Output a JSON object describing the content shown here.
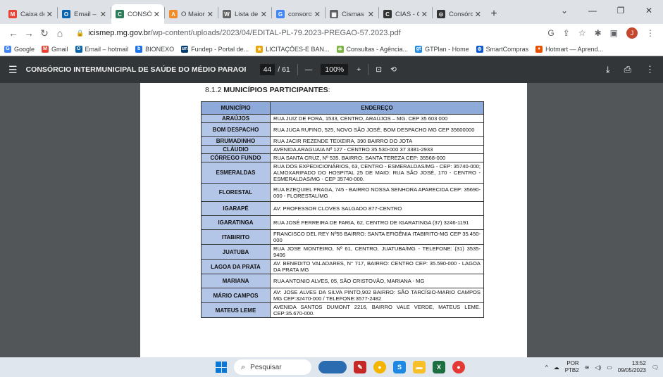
{
  "tabs": [
    {
      "icon": "gmail-icon",
      "color": "#ea4335",
      "glyph": "M",
      "title": "Caixa de e"
    },
    {
      "icon": "outlook-icon",
      "color": "#0a64ad",
      "glyph": "O",
      "title": "Email – Jul"
    },
    {
      "icon": "consorcio-icon",
      "color": "#2e7d5b",
      "glyph": "C",
      "title": "CONSÓRC",
      "active": true
    },
    {
      "icon": "maior-icon",
      "color": "#f28c28",
      "glyph": "Λ",
      "title": "O Maior M"
    },
    {
      "icon": "wikipedia-icon",
      "color": "#666666",
      "glyph": "W",
      "title": "Lista de m"
    },
    {
      "icon": "google-icon",
      "color": "#4285f4",
      "glyph": "G",
      "title": "consorcio"
    },
    {
      "icon": "cismas-icon",
      "color": "#5f6368",
      "glyph": "▦",
      "title": "Cismas - C"
    },
    {
      "icon": "cias-icon",
      "color": "#333333",
      "glyph": "C",
      "title": "CIAS - Con"
    },
    {
      "icon": "consorcio2-icon",
      "color": "#333333",
      "glyph": "⊙",
      "title": "Consórcio"
    }
  ],
  "address": {
    "host": "icismep.mg.gov.br",
    "path": "/wp-content/uploads/2023/04/EDITAL-PL-79.2023-PREGAO-57.2023.pdf",
    "profile_initial": "J"
  },
  "bookmarks": [
    {
      "glyph": "G",
      "color": "#4285f4",
      "label": "Google"
    },
    {
      "glyph": "M",
      "color": "#ea4335",
      "label": "Gmail"
    },
    {
      "glyph": "O",
      "color": "#0a64ad",
      "label": "Email – hotmail"
    },
    {
      "glyph": "b",
      "color": "#1a73e8",
      "label": "BIONEXO"
    },
    {
      "glyph": "un",
      "color": "#003c71",
      "label": "Fundep - Portal de..."
    },
    {
      "glyph": "★",
      "color": "#e8a400",
      "label": "LICITAÇÕES-E BAN..."
    },
    {
      "glyph": "✲",
      "color": "#7cb342",
      "label": "Consultas - Agência..."
    },
    {
      "glyph": "gt",
      "color": "#1e88e5",
      "label": "GTPlan - Home"
    },
    {
      "glyph": "⚙",
      "color": "#0b57d0",
      "label": "SmartCompras"
    },
    {
      "glyph": "♦",
      "color": "#e65100",
      "label": "Hotmart — Aprend..."
    }
  ],
  "pdf": {
    "title": "CONSÓRCIO INTERMUNICIPAL DE SAÚDE DO MÉDIO PARAOPEBA – C...",
    "page_current": "44",
    "page_total": "/ 61",
    "zoom": "100%"
  },
  "document": {
    "section_number": "8.1.2",
    "section_title": "MUNICÍPIOS PARTICIPANTES",
    "section_suffix": ":",
    "col_municipio": "MUNICÍPIO",
    "col_endereco": "ENDEREÇO",
    "rows": [
      {
        "municipio": "ARAÚJOS",
        "endereco": "RUA JUIZ DE FORA, 1533, CENTRO, ARAÚJOS – MG. CEP 35 603 000",
        "h": "r1"
      },
      {
        "municipio": "BOM DESPACHO",
        "endereco": "RUA JUCA RUFINO, 525, NOVO SÃO JOSÉ, BOM DESPACHO MG CEP 35600000",
        "h": "r2"
      },
      {
        "municipio": "BRUMADINHO",
        "endereco": "RUA JACIR REZENDE TEIXEIRA, 390 BAIRRO DO JOTA",
        "h": "r1"
      },
      {
        "municipio": "CLÁUDIO",
        "endereco": "AVENIDA ARAGUAIA Nº 127 - CENTRO 35.530-000 37 3381-2933",
        "h": "r1"
      },
      {
        "municipio": "CÓRREGO FUNDO",
        "endereco": "RUA SANTA CRUZ, Nº 535. BAIRRO: SANTA TEREZA CEP: 35568-000",
        "h": "r1"
      },
      {
        "municipio": "ESMERALDAS",
        "endereco": "RUA DOS EXPEDICIONÁRIOS, 63, CENTRO - ESMERALDAS/MG - CEP: 35740-000; ALMOXARIFADO DO HOSPITAL 25 DE MAIO: RUA SÃO JOSÉ, 170 - CENTRO - ESMERALDAS/MG - CEP 35740-000.",
        "h": "r3"
      },
      {
        "municipio": "FLORESTAL",
        "endereco": "RUA EZEQUIEL FRAGA, 745 - BAIRRO NOSSA SENHORA APARECIDA CEP: 35690-000 - FLORESTAL/MG",
        "h": "r4"
      },
      {
        "municipio": "IGARAPÉ",
        "endereco": "AV: PROFESSOR CLOVES SALGADO 877-CENTRO",
        "h": "r2"
      },
      {
        "municipio": "IGARATINGA",
        "endereco": "RUA JOSÉ FERREIRA DE FARIA, 62, CENTRO DE IGARATINGA (37) 3246-1191",
        "h": "r2"
      },
      {
        "municipio": "ITABIRITO",
        "endereco": "FRANCISCO DEL REY Nº55 BAIRRO: SANTA EFIGÊNIA ITABIRITO-MG CEP 35.450-000",
        "h": "r2"
      },
      {
        "municipio": "JUATUBA",
        "endereco": "RUA JOSE MONTEIRO, Nº 61, CENTRO, JUATUBA/MG - TELEFONE: (31) 3535-9406",
        "h": "r2"
      },
      {
        "municipio": "LAGOA DA PRATA",
        "endereco": "AV. BENEDITO VALADARES, N° 717, BAIRRO: CENTRO CEP: 35.590-000 - LAGOA DA PRATA MG",
        "h": "r2"
      },
      {
        "municipio": "MARIANA",
        "endereco": "RUA ANTONIO ALVES, 05, SÃO CRISTOVÃO, MARIANA - MG",
        "h": "r2"
      },
      {
        "municipio": "MÁRIO CAMPOS",
        "endereco": "AV: JOSE ALVES DA SILVA PINTO,902 BAIRRO: SÃO TARCÍSIO-MARIO CAMPOS MG CEP:32470-000 / TELEFONE:3577-2482",
        "h": "r2"
      },
      {
        "municipio": "MATEUS LEME",
        "endereco": "AVENIDA SANTOS DUMONT 2216, BAIRRO VALE VERDE, MATEUS LEME. CEP:35.670-000.",
        "h": "r2"
      }
    ]
  },
  "taskbar": {
    "search_placeholder": "Pesquisar",
    "lang_top": "POR",
    "lang_bottom": "PTB2",
    "time": "13:52",
    "date": "09/05/2023"
  }
}
